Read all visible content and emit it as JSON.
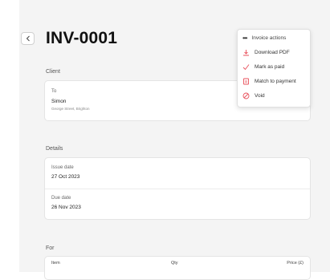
{
  "header": {
    "title": "INV-0001"
  },
  "client": {
    "section_label": "Client",
    "to_label": "To",
    "name": "Simon",
    "address": "George Street, Brighton"
  },
  "details": {
    "section_label": "Details",
    "issue_label": "Issue date",
    "issue_value": "27 Oct 2023",
    "due_label": "Due date",
    "due_value": "26 Nov 2023"
  },
  "items": {
    "section_label": "For",
    "columns": [
      "Item",
      "Qty",
      "Price (£)"
    ]
  },
  "menu": {
    "header": "Invoice actions",
    "items": [
      {
        "label": "Download PDF",
        "icon": "download-icon"
      },
      {
        "label": "Mark as paid",
        "icon": "check-icon"
      },
      {
        "label": "Match to payment",
        "icon": "match-payment-icon"
      },
      {
        "label": "Void",
        "icon": "void-icon"
      }
    ],
    "accent_color": "#e8505b"
  }
}
